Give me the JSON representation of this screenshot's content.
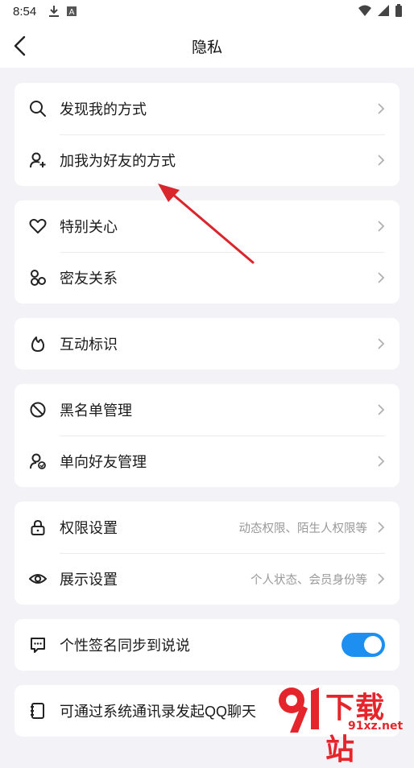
{
  "status_bar": {
    "time": "8:54",
    "icons_left": [
      "download-icon",
      "a-badge-icon"
    ],
    "icons_right": [
      "wifi-icon",
      "signal-icon",
      "battery-icon"
    ]
  },
  "header": {
    "title": "隐私",
    "back_icon": "chevron-left-icon"
  },
  "groups": [
    {
      "items": [
        {
          "icon": "search-icon",
          "label": "发现我的方式"
        },
        {
          "icon": "add-friend-icon",
          "label": "加我为好友的方式"
        }
      ]
    },
    {
      "items": [
        {
          "icon": "heart-icon",
          "label": "特别关心"
        },
        {
          "icon": "close-friends-icon",
          "label": "密友关系"
        }
      ]
    },
    {
      "items": [
        {
          "icon": "flame-icon",
          "label": "互动标识"
        }
      ]
    },
    {
      "items": [
        {
          "icon": "block-icon",
          "label": "黑名单管理"
        },
        {
          "icon": "one-way-friend-icon",
          "label": "单向好友管理"
        }
      ]
    },
    {
      "items": [
        {
          "icon": "lock-icon",
          "label": "权限设置",
          "subtitle": "动态权限、陌生人权限等"
        },
        {
          "icon": "eye-icon",
          "label": "展示设置",
          "subtitle": "个人状态、会员身份等"
        }
      ]
    },
    {
      "items": [
        {
          "icon": "message-icon",
          "label": "个性签名同步到说说",
          "toggle": true
        }
      ]
    },
    {
      "items": [
        {
          "icon": "contacts-book-icon",
          "label": "可通过系统通讯录发起QQ聊天"
        }
      ]
    }
  ],
  "watermark": {
    "text": "下载站",
    "url": "91xz.net",
    "logo": "91"
  },
  "colors": {
    "background": "#f2f2f7",
    "toggle_on": "#1d8ff0",
    "annotation_arrow": "#d9262c"
  }
}
